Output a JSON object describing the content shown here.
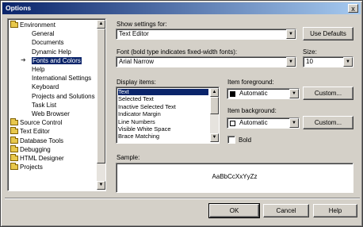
{
  "window": {
    "title": "Options",
    "close_glyph": "x"
  },
  "tree": {
    "items": [
      {
        "label": "Environment",
        "type": "folder-open"
      },
      {
        "label": "General",
        "type": "page"
      },
      {
        "label": "Documents",
        "type": "page"
      },
      {
        "label": "Dynamic Help",
        "type": "page"
      },
      {
        "label": "Fonts and Colors",
        "type": "page",
        "selected": true
      },
      {
        "label": "Help",
        "type": "page"
      },
      {
        "label": "International Settings",
        "type": "page"
      },
      {
        "label": "Keyboard",
        "type": "page"
      },
      {
        "label": "Projects and Solutions",
        "type": "page"
      },
      {
        "label": "Task List",
        "type": "page"
      },
      {
        "label": "Web Browser",
        "type": "page"
      },
      {
        "label": "Source Control",
        "type": "folder"
      },
      {
        "label": "Text Editor",
        "type": "folder"
      },
      {
        "label": "Database Tools",
        "type": "folder"
      },
      {
        "label": "Debugging",
        "type": "folder"
      },
      {
        "label": "HTML Designer",
        "type": "folder"
      },
      {
        "label": "Projects",
        "type": "folder"
      }
    ],
    "selected_marker": "➜"
  },
  "settings": {
    "show_settings_label": "Show settings for:",
    "show_settings_value": "Text Editor",
    "use_defaults_label": "Use Defaults",
    "font_label": "Font (bold type indicates fixed-width fonts):",
    "font_value": "Arial Narrow",
    "size_label": "Size:",
    "size_value": "10",
    "display_items_label": "Display items:",
    "display_items": [
      "Text",
      "Selected Text",
      "Inactive Selected Text",
      "Indicator Margin",
      "Line Numbers",
      "Visible White Space",
      "Brace Matching"
    ],
    "display_items_selected_index": 0,
    "item_foreground_label": "Item foreground:",
    "item_foreground_value": "Automatic",
    "item_foreground_color": "#000000",
    "item_background_label": "Item background:",
    "item_background_value": "Automatic",
    "item_background_color": "#ffffff",
    "custom_label": "Custom...",
    "bold_label": "Bold",
    "bold_checked": false,
    "sample_label": "Sample:",
    "sample_text": "AaBbCcXxYyZz"
  },
  "footer": {
    "ok_label": "OK",
    "cancel_label": "Cancel",
    "help_label": "Help"
  },
  "colors": {
    "title_start": "#0a246a",
    "title_end": "#a6caf0",
    "face": "#d4d0c8",
    "selection": "#0a246a"
  }
}
